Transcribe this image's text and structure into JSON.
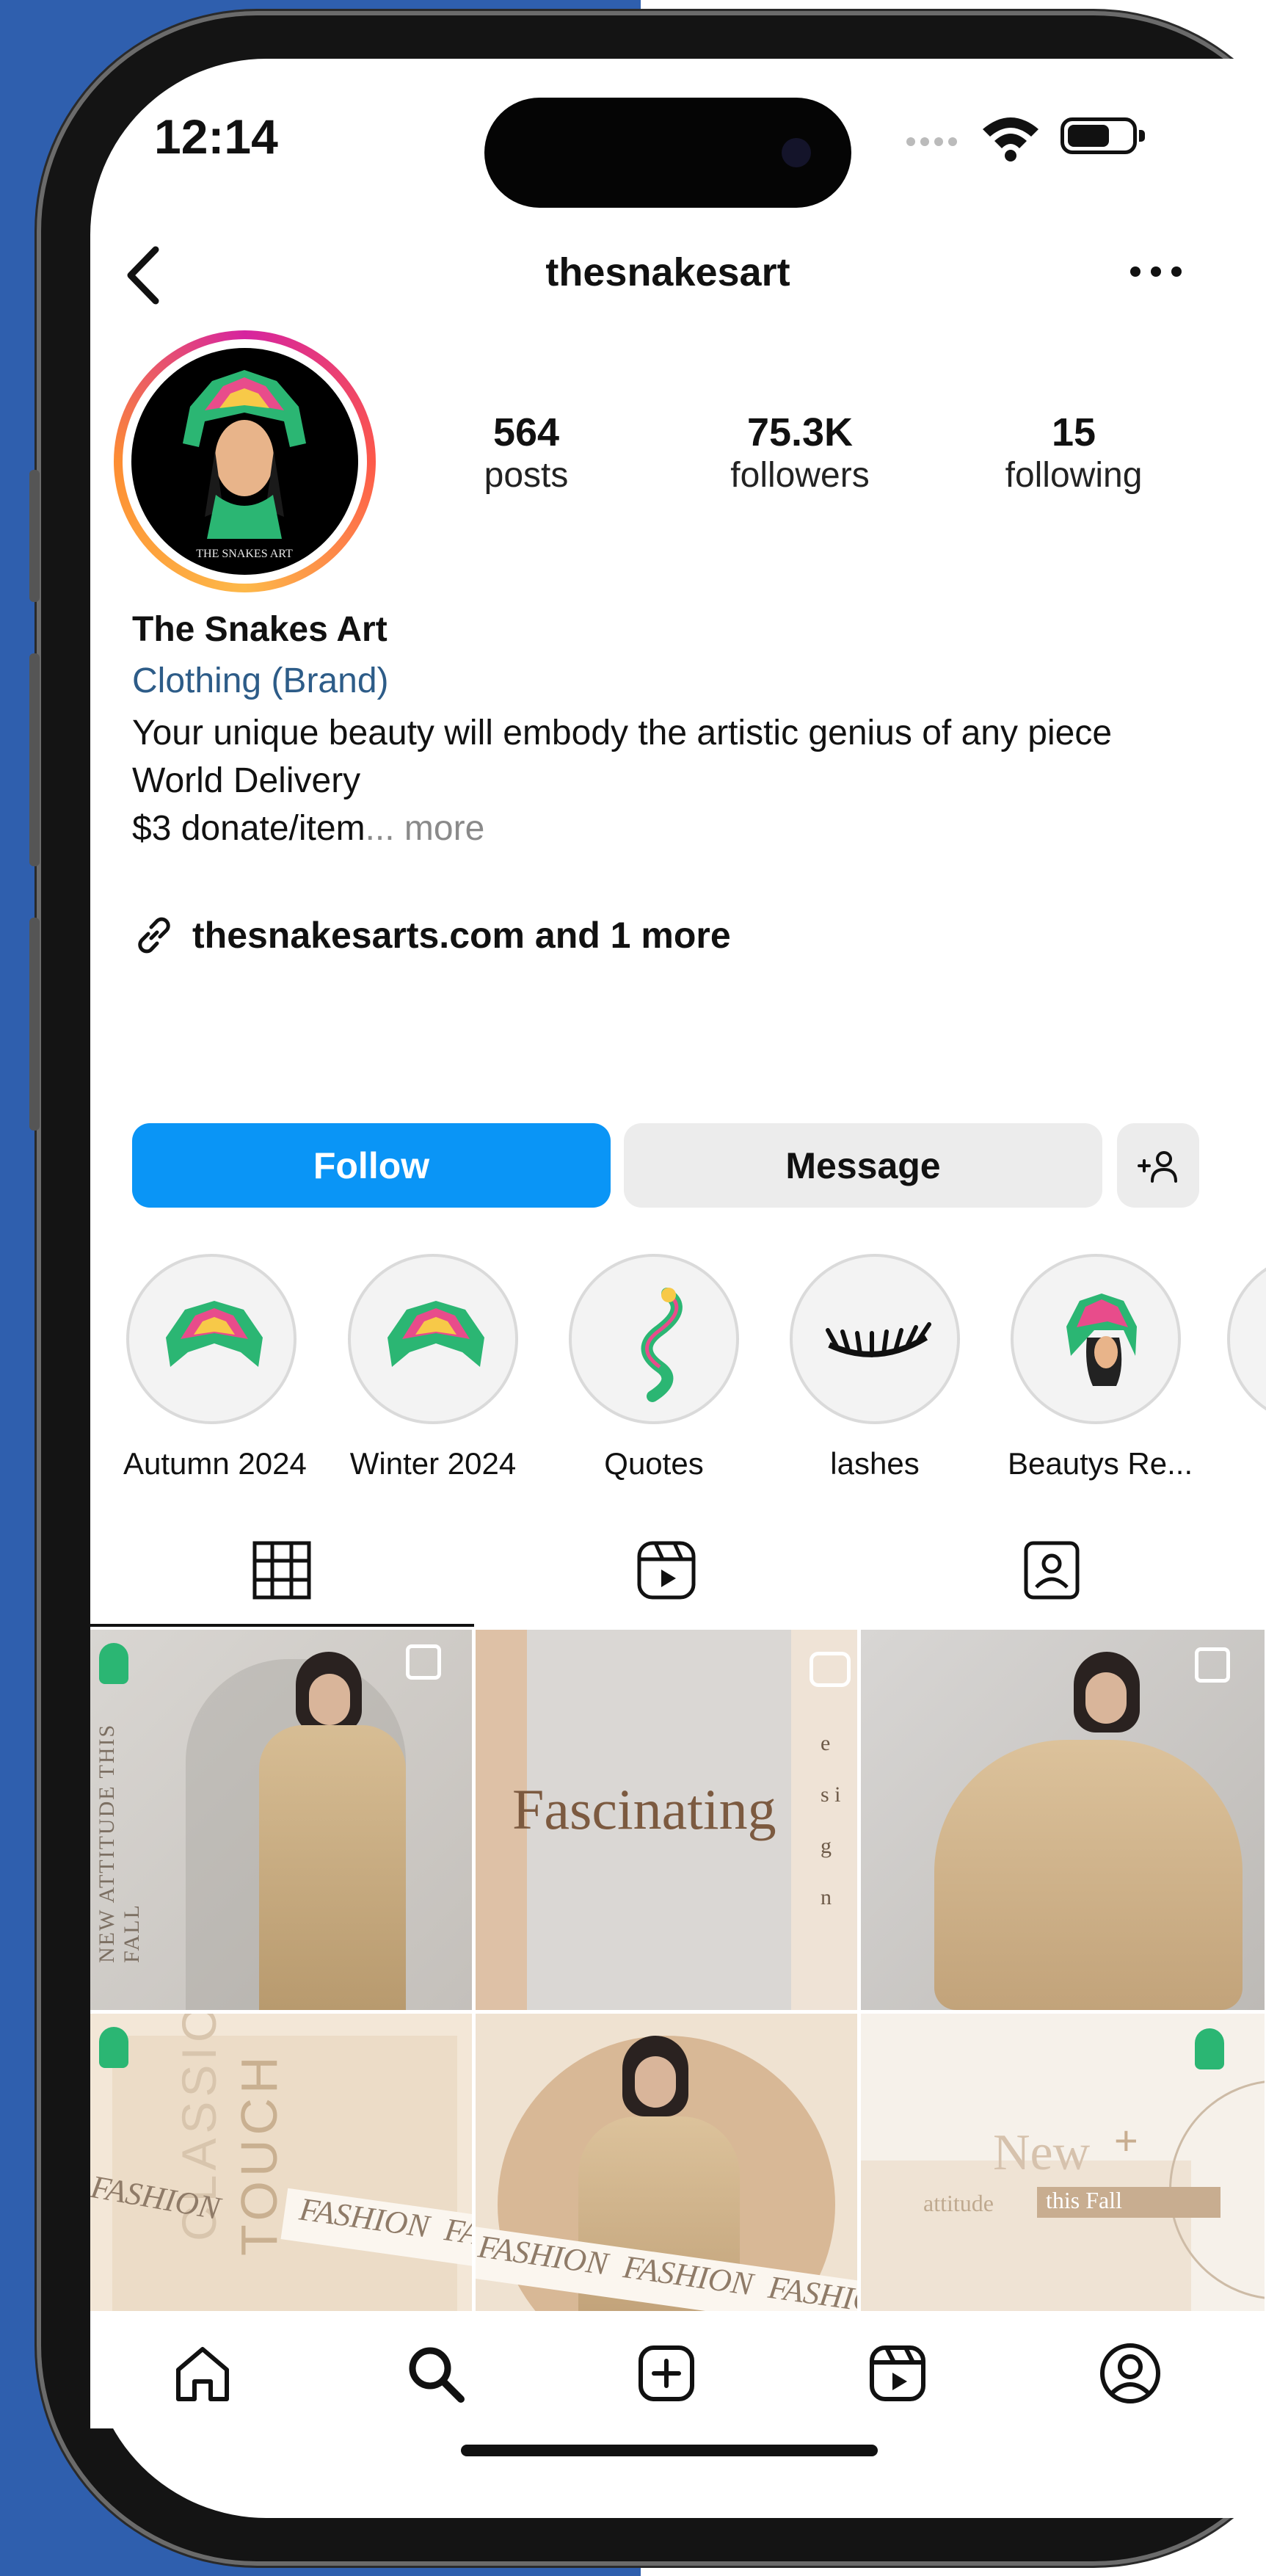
{
  "status_bar": {
    "time": "12:14"
  },
  "header": {
    "username": "thesnakesart"
  },
  "stats": [
    {
      "num": "564",
      "label": "posts"
    },
    {
      "num": "75.3K",
      "label": "followers"
    },
    {
      "num": "15",
      "label": "following"
    }
  ],
  "bio": {
    "name": "The Snakes Art",
    "category": "Clothing (Brand)",
    "line1": "Your unique beauty will embody the artistic genius of any piece",
    "line2": "World Delivery",
    "line3": "$3 donate/item",
    "more": "... more",
    "link": "thesnakesarts.com and 1 more"
  },
  "actions": {
    "follow": "Follow",
    "message": "Message"
  },
  "highlights": [
    {
      "label": "Autumn 2024"
    },
    {
      "label": "Winter 2024"
    },
    {
      "label": "Quotes"
    },
    {
      "label": "lashes"
    },
    {
      "label": "Beautys Re..."
    }
  ],
  "avatar_text": "THE SNAKES ART",
  "posts": {
    "tile1_text": "NEW ATTITUDE THIS FALL",
    "tile2_text": "Fascinating",
    "tile2_side": "e s i g n",
    "tile4_classic": "CLASSIC",
    "tile4_touch": "TOUCH",
    "tile4_fashion": "FASHION",
    "tile4_band": "FASHION  FASHION  FASHION  FASHION",
    "tile6_new": "New",
    "tile6_sub": "attitude",
    "tile6_sub2": "this Fall"
  },
  "colors": {
    "background_blue": "#2f5fae",
    "follow_blue": "#0a95f6",
    "category_blue": "#2d5c88"
  },
  "icons": {
    "tabs": [
      "grid-icon",
      "reels-icon",
      "tagged-icon"
    ],
    "nav": [
      "home-icon",
      "search-icon",
      "create-icon",
      "reels-icon",
      "profile-icon"
    ]
  }
}
